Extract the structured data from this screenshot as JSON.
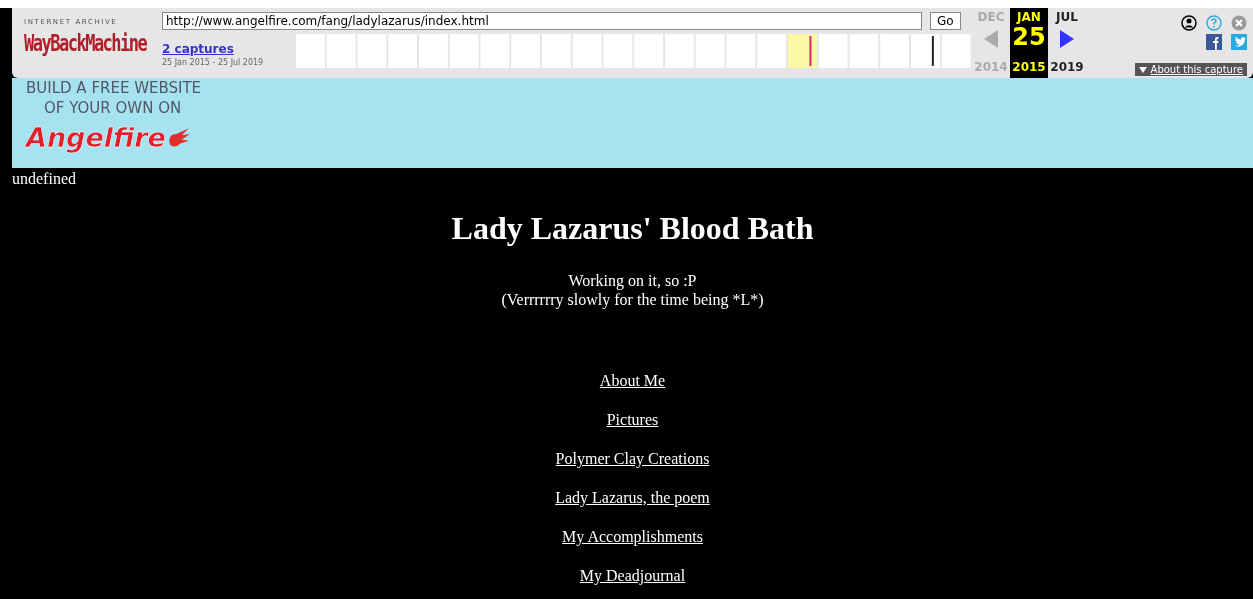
{
  "toolbar": {
    "logo_caption": "INTERNET ARCHIVE",
    "logo": "WayBackMachine",
    "url": "http://www.angelfire.com/fang/ladylazarus/index.html",
    "go_button": "Go",
    "captures_link": "2 captures",
    "date_range": "25 Jan 2015 - 25 Jul 2019",
    "calendar": {
      "columns": [
        {
          "month": "DEC",
          "year": "2014",
          "selected": false
        },
        {
          "month": "JAN",
          "year": "2015",
          "selected": true
        },
        {
          "month": "JUL",
          "year": "2019",
          "selected": false
        }
      ],
      "day": "25",
      "prev_arrow": {
        "disabled": true
      },
      "next_arrow": {
        "disabled": false
      }
    },
    "about_button": "About this capture"
  },
  "banner": {
    "lines": [
      "BUILD A FREE WEBSITE",
      "OF YOUR OWN ON"
    ],
    "brand": "Angelfire"
  },
  "page": {
    "note": "undefined",
    "title": "Lady Lazarus' Blood Bath",
    "subtitle": [
      "Working on it, so :P",
      "(Verrrrrry slowly for the time being *L*)"
    ],
    "links": [
      "About Me",
      "Pictures",
      "Polymer Clay Creations",
      "Lady Lazarus, the poem",
      "My Accomplishments",
      "My Deadjournal"
    ]
  }
}
